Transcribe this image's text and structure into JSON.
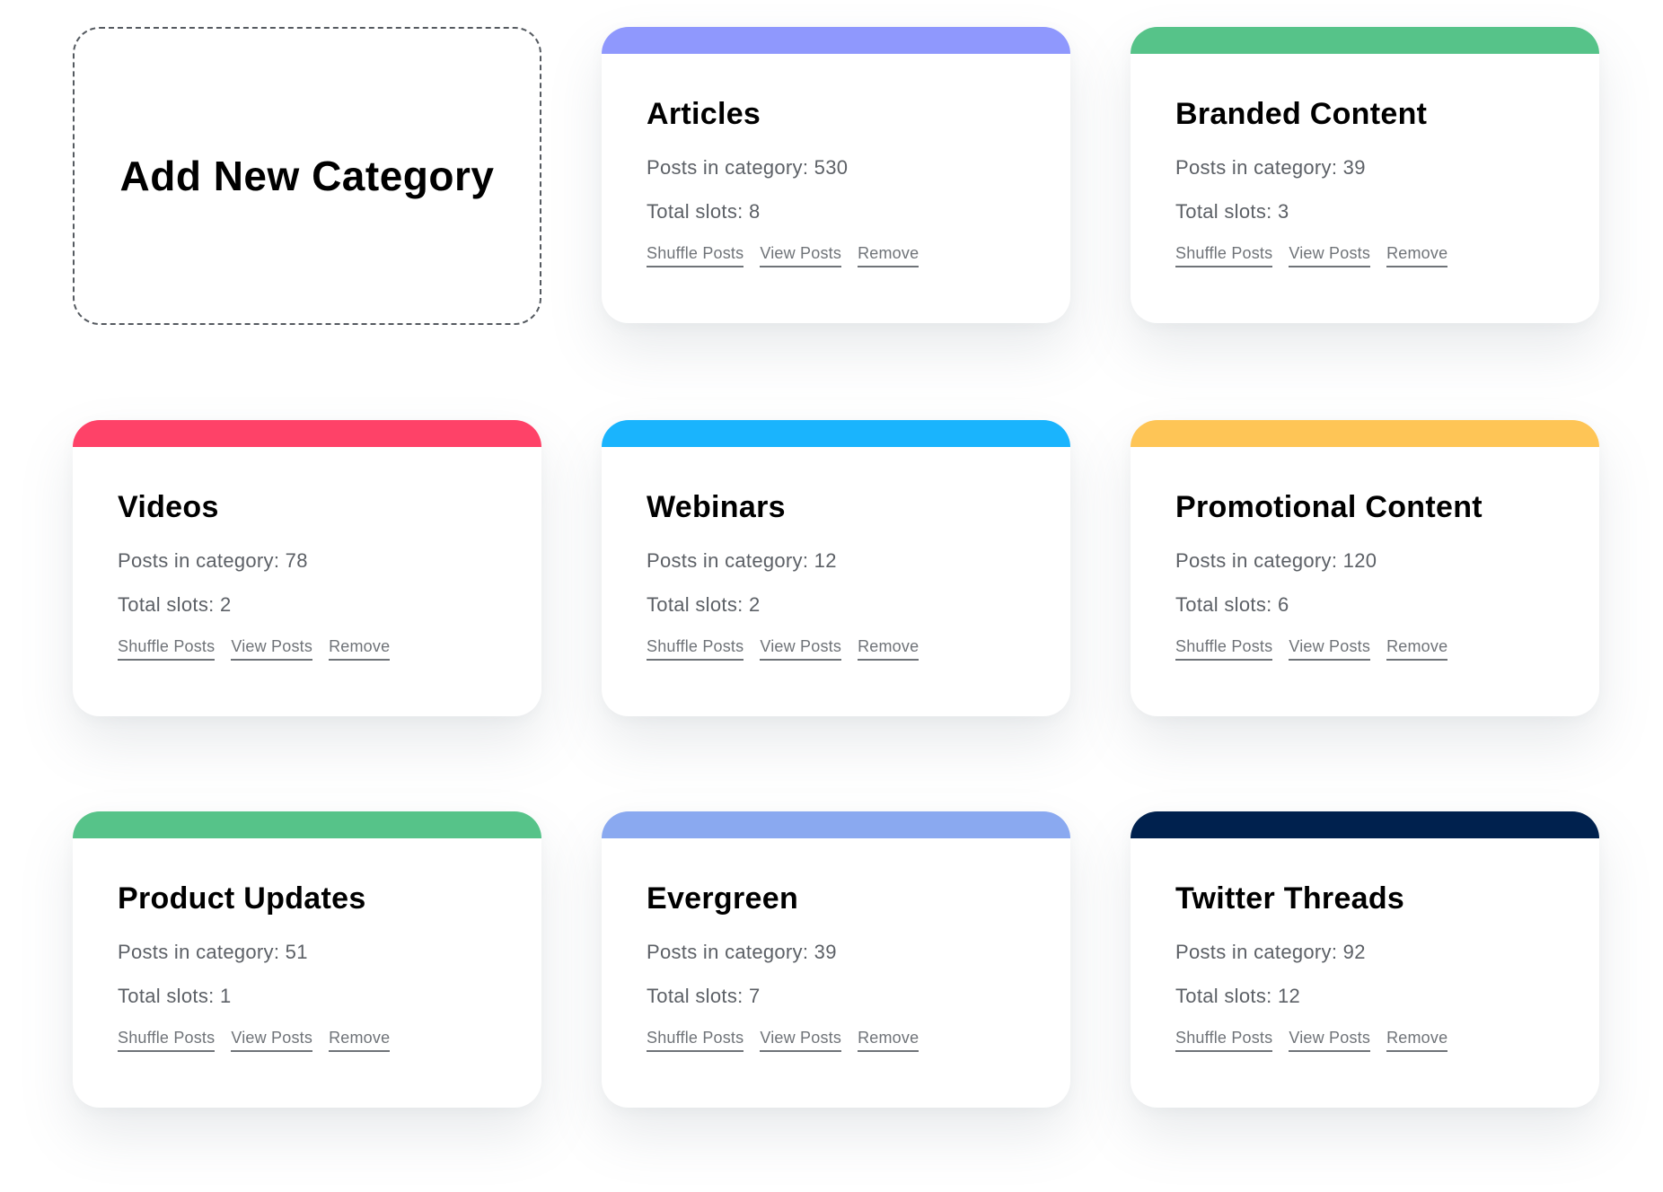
{
  "add_card": {
    "label": "Add New Category"
  },
  "labels": {
    "posts_prefix": "Posts in category: ",
    "slots_prefix": "Total slots: "
  },
  "actions": {
    "shuffle": "Shuffle Posts",
    "view": "View Posts",
    "remove": "Remove"
  },
  "categories": [
    {
      "title": "Articles",
      "posts": 530,
      "slots": 8,
      "color": "#8f98fd"
    },
    {
      "title": "Branded Content",
      "posts": 39,
      "slots": 3,
      "color": "#56c389"
    },
    {
      "title": "Videos",
      "posts": 78,
      "slots": 2,
      "color": "#fe4268"
    },
    {
      "title": "Webinars",
      "posts": 12,
      "slots": 2,
      "color": "#1ab4fd"
    },
    {
      "title": "Promotional Content",
      "posts": 120,
      "slots": 6,
      "color": "#fec556"
    },
    {
      "title": "Product Updates",
      "posts": 51,
      "slots": 1,
      "color": "#56c389"
    },
    {
      "title": "Evergreen",
      "posts": 39,
      "slots": 7,
      "color": "#8aa9f0"
    },
    {
      "title": "Twitter Threads",
      "posts": 92,
      "slots": 12,
      "color": "#00214e"
    }
  ]
}
